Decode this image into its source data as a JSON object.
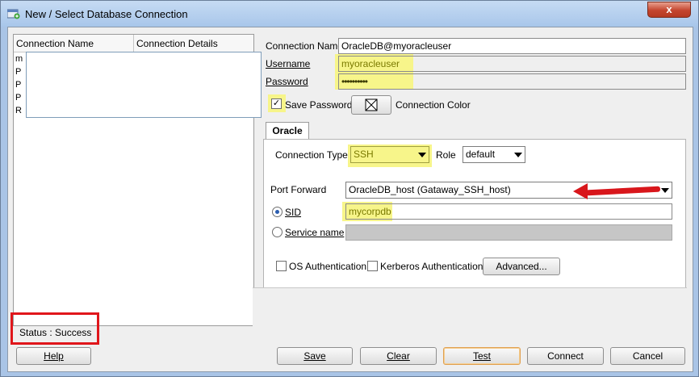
{
  "window": {
    "title": "New / Select Database Connection",
    "close_label": "x"
  },
  "list": {
    "headers": [
      "Connection Name",
      "Connection Details"
    ],
    "row_stubs": [
      "m",
      "P",
      "P",
      "P",
      "R"
    ]
  },
  "form": {
    "connection_name_label": "Connection Name",
    "connection_name_value": "OracleDB@myoracleuser",
    "username_label": "Username",
    "username_value": "myoracleuser",
    "password_label": "Password",
    "password_value": "••••••••••",
    "save_password_label": "Save Password",
    "connection_color_label": "Connection Color",
    "tab_label": "Oracle",
    "connection_type_label": "Connection Type",
    "connection_type_value": "SSH",
    "role_label": "Role",
    "role_value": "default",
    "port_forward_label": "Port Forward",
    "port_forward_value": "OracleDB_host (Gataway_SSH_host)",
    "sid_label": "SID",
    "sid_value": "mycorpdb",
    "service_name_label": "Service name",
    "os_auth_label": "OS Authentication",
    "kerberos_auth_label": "Kerberos Authentication",
    "advanced_label": "Advanced..."
  },
  "status": {
    "text": "Status : Success"
  },
  "buttons": {
    "help": "Help",
    "save": "Save",
    "clear": "Clear",
    "test": "Test",
    "connect": "Connect",
    "cancel": "Cancel"
  },
  "colors": {
    "highlight": "#f7f58a",
    "annotation_red": "#e0161b",
    "focus_border": "#e0a050"
  }
}
